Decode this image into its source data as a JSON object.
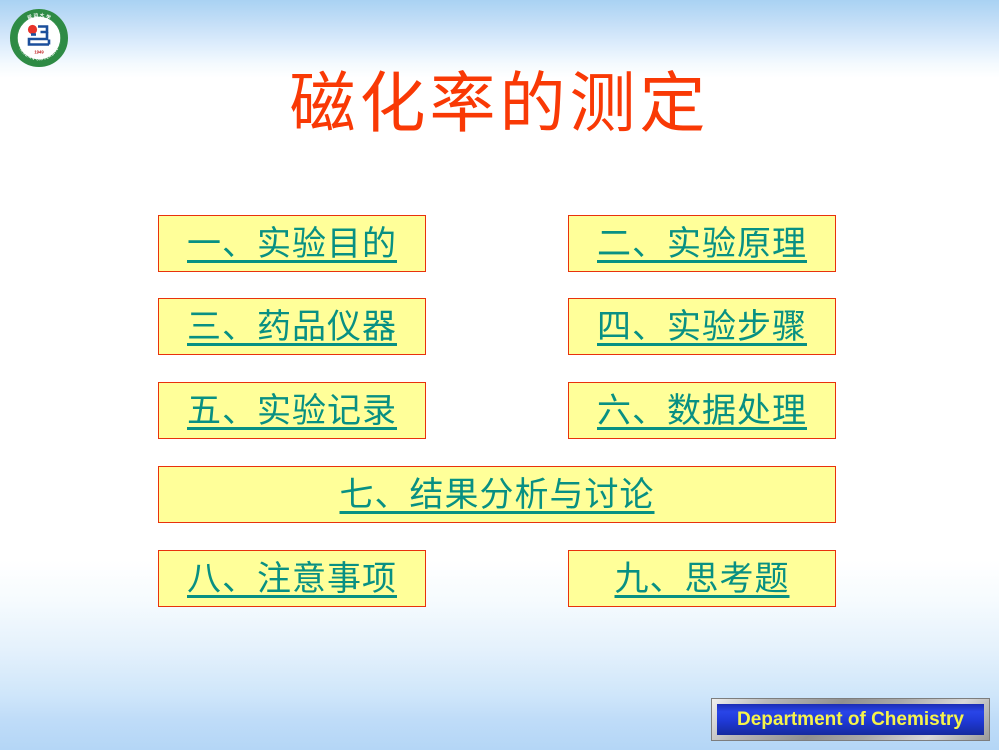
{
  "slide": {
    "title": "磁化率的测定",
    "title_color": "#f93905",
    "background_accent_color": "#a9d2f3"
  },
  "logo": {
    "name": "yanbian-university-seal",
    "ring_text_latin": "YANBIAN UNIVERSITY",
    "ring_text_hanja": "延边大学",
    "year": "1949",
    "ring_color": "#2e8b45",
    "mark_color": "#1b4f9c",
    "dot_color": "#e8332a"
  },
  "menu": {
    "button_bg": "#ffff99",
    "button_border": "#e8320c",
    "button_text_color": "#089083",
    "rows": [
      {
        "left": "一、实验目的",
        "right": "二、实验原理"
      },
      {
        "left": "三、药品仪器",
        "right": "四、实验步骤"
      },
      {
        "left": "五、实验记录",
        "right": "六、数据处理"
      }
    ],
    "wide": "七、结果分析与讨论",
    "last_row": {
      "left": "八、注意事项",
      "right": "九、思考题"
    }
  },
  "footer": {
    "text": "Department of Chemistry",
    "text_color": "#f6f34a",
    "panel_color": "#1f39d6",
    "frame_color": "#9a9a9a"
  }
}
